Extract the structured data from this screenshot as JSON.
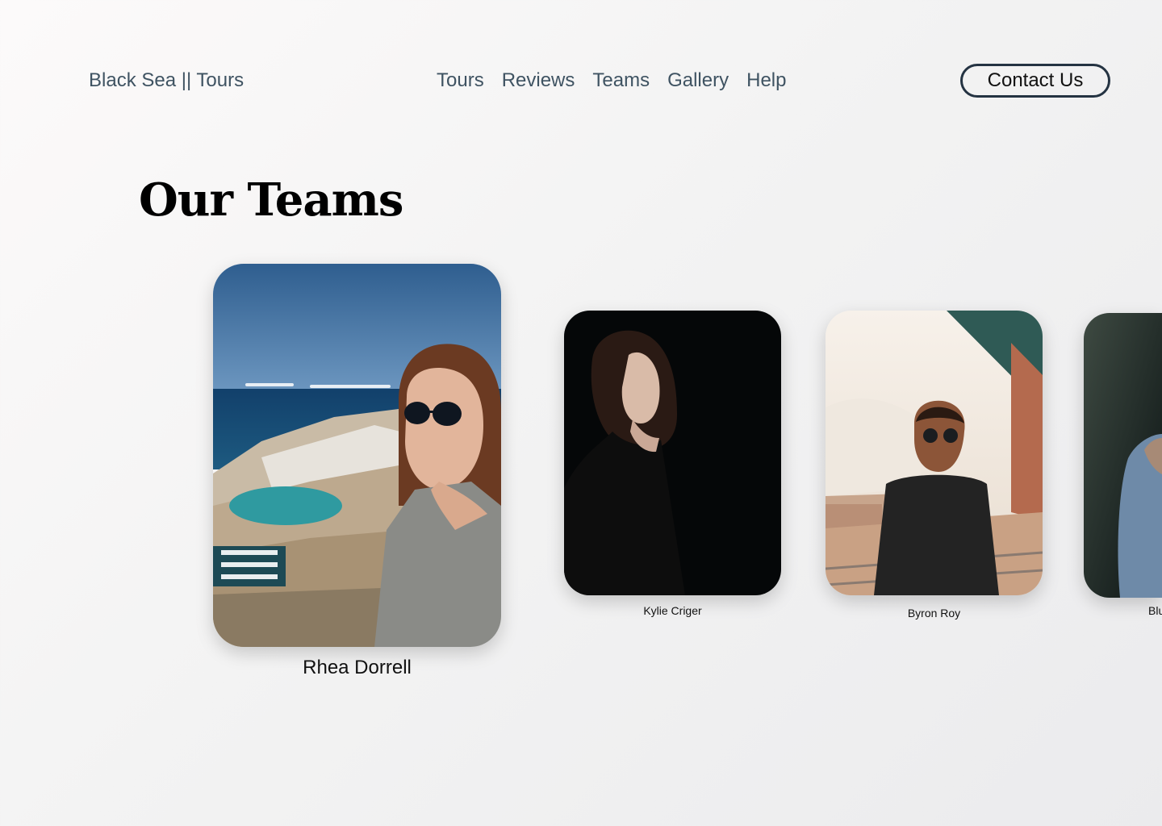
{
  "header": {
    "brand": "Black Sea || Tours",
    "nav": [
      "Tours",
      "Reviews",
      "Teams",
      "Gallery",
      "Help"
    ],
    "contact_label": "Contact Us"
  },
  "section": {
    "title": "Our Teams"
  },
  "team": [
    {
      "name": "Rhea Dorrell"
    },
    {
      "name": "Kylie Criger"
    },
    {
      "name": "Byron Roy"
    },
    {
      "name": "Blu"
    }
  ]
}
